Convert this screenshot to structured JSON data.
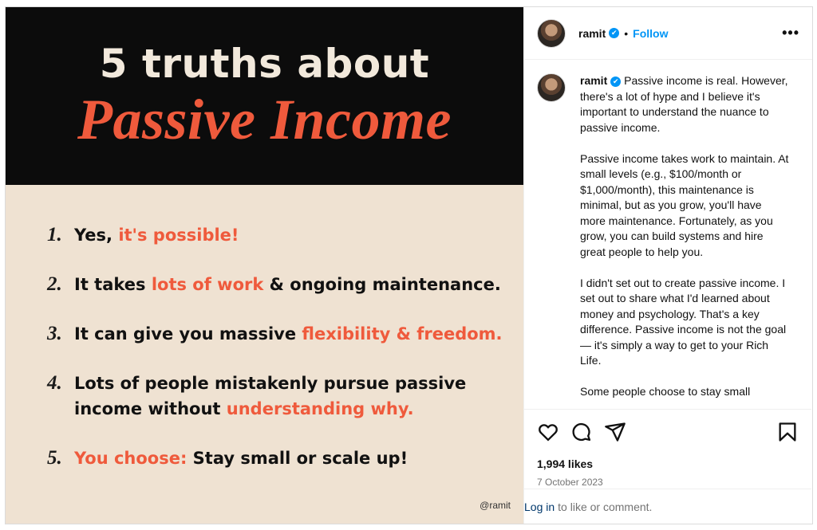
{
  "media": {
    "headline": "5 truths about",
    "headline_accent": "Passive Income",
    "accent_color": "#ef5a3c",
    "handle": "@ramit",
    "truths": [
      {
        "num": "1.",
        "parts": [
          {
            "t": "Yes, ",
            "hl": false
          },
          {
            "t": "it's possible!",
            "hl": true
          }
        ]
      },
      {
        "num": "2.",
        "parts": [
          {
            "t": "It takes ",
            "hl": false
          },
          {
            "t": "lots of work",
            "hl": true
          },
          {
            "t": " & ongoing maintenance.",
            "hl": false
          }
        ]
      },
      {
        "num": "3.",
        "parts": [
          {
            "t": "It can give you massive ",
            "hl": false
          },
          {
            "t": "flexibility & freedom.",
            "hl": true
          }
        ]
      },
      {
        "num": "4.",
        "line1": "Lots of people mistakenly pursue passive",
        "line2_pre": "income without ",
        "line2_hl": "understanding why."
      },
      {
        "num": "5.",
        "parts": [
          {
            "t": "You choose:",
            "hl": true
          },
          {
            "t": " Stay small or scale up!",
            "hl": false
          }
        ]
      }
    ]
  },
  "header": {
    "username": "ramit",
    "verified_icon": "✔",
    "separator": "•",
    "follow_label": "Follow",
    "more_label": "•••"
  },
  "caption": {
    "username": "ramit",
    "p1": "Passive income is real. However, there's a lot of hype and I believe it's important to understand the nuance to passive income.",
    "p2": "Passive income takes work to maintain. At small levels (e.g., $100/month or $1,000/month), this maintenance is minimal, but as you grow, you'll have more maintenance. Fortunately, as you grow, you can build systems and hire great people to help you.",
    "p3": "I didn't set out to create passive income. I set out to share what I'd learned about money and psychology. That's a key difference. Passive income is not the goal — it's simply a way to get to your Rich Life.",
    "p4": "Some people choose to stay small"
  },
  "engagement": {
    "likes": "1,994 likes",
    "date": "7 October 2023"
  },
  "login": {
    "link": "Log in",
    "rest": "to like or comment."
  }
}
